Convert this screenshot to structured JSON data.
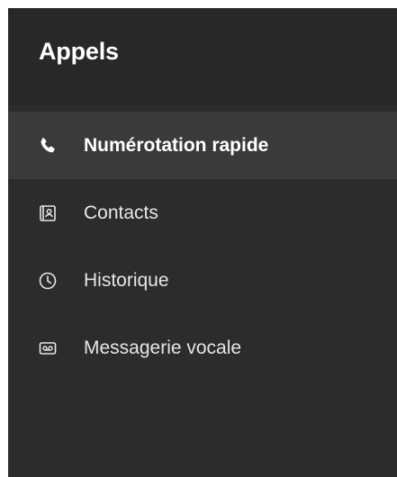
{
  "header": {
    "title": "Appels"
  },
  "nav": {
    "items": [
      {
        "label": "Numérotation rapide",
        "icon": "phone-icon",
        "active": true
      },
      {
        "label": "Contacts",
        "icon": "contact-card-icon",
        "active": false
      },
      {
        "label": "Historique",
        "icon": "clock-icon",
        "active": false
      },
      {
        "label": "Messagerie vocale",
        "icon": "voicemail-icon",
        "active": false
      }
    ]
  },
  "colors": {
    "panel_background": "#2d2c2c",
    "header_background": "#292828",
    "active_item_background": "#3b3a39",
    "text": "#ffffff"
  }
}
